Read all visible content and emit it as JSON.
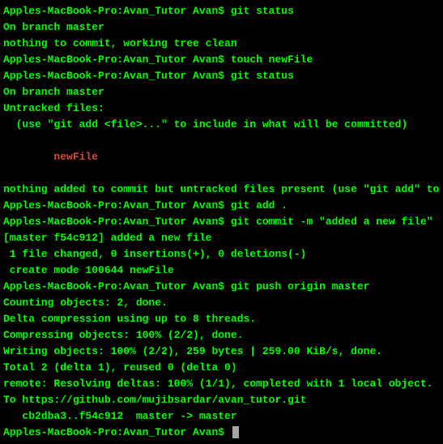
{
  "lines": [
    {
      "segments": [
        {
          "cls": "prompt",
          "key": "l0s0"
        },
        {
          "cls": "cmd",
          "key": "l0s1"
        }
      ],
      "l0s0": "Apples-MacBook-Pro:Avan_Tutor Avan$ ",
      "l0s1": "git status"
    },
    {
      "segments": [
        {
          "cls": "out",
          "key": "l1s0"
        }
      ],
      "l1s0": "On branch master"
    },
    {
      "segments": [
        {
          "cls": "out",
          "key": "l2s0"
        }
      ],
      "l2s0": "nothing to commit, working tree clean"
    },
    {
      "segments": [
        {
          "cls": "prompt",
          "key": "l3s0"
        },
        {
          "cls": "cmd",
          "key": "l3s1"
        }
      ],
      "l3s0": "Apples-MacBook-Pro:Avan_Tutor Avan$ ",
      "l3s1": "touch newFile"
    },
    {
      "segments": [
        {
          "cls": "prompt",
          "key": "l4s0"
        },
        {
          "cls": "cmd",
          "key": "l4s1"
        }
      ],
      "l4s0": "Apples-MacBook-Pro:Avan_Tutor Avan$ ",
      "l4s1": "git status"
    },
    {
      "segments": [
        {
          "cls": "out",
          "key": "l5s0"
        }
      ],
      "l5s0": "On branch master"
    },
    {
      "segments": [
        {
          "cls": "out",
          "key": "l6s0"
        }
      ],
      "l6s0": "Untracked files:"
    },
    {
      "segments": [
        {
          "cls": "out",
          "key": "l7s0"
        }
      ],
      "l7s0": "  (use \"git add <file>...\" to include in what will be committed)"
    },
    {
      "blank": true
    },
    {
      "segments": [
        {
          "cls": "untracked",
          "key": "l9s0"
        }
      ],
      "l9s0": "        newFile"
    },
    {
      "blank": true
    },
    {
      "segments": [
        {
          "cls": "out",
          "key": "l11s0"
        }
      ],
      "l11s0": "nothing added to commit but untracked files present (use \"git add\" to track)"
    },
    {
      "segments": [
        {
          "cls": "prompt",
          "key": "l12s0"
        },
        {
          "cls": "cmd",
          "key": "l12s1"
        }
      ],
      "l12s0": "Apples-MacBook-Pro:Avan_Tutor Avan$ ",
      "l12s1": "git add ."
    },
    {
      "segments": [
        {
          "cls": "prompt",
          "key": "l13s0"
        },
        {
          "cls": "cmd",
          "key": "l13s1"
        }
      ],
      "l13s0": "Apples-MacBook-Pro:Avan_Tutor Avan$ ",
      "l13s1": "git commit -m \"added a new file\""
    },
    {
      "segments": [
        {
          "cls": "out",
          "key": "l14s0"
        }
      ],
      "l14s0": "[master f54c912] added a new file"
    },
    {
      "segments": [
        {
          "cls": "out",
          "key": "l15s0"
        }
      ],
      "l15s0": " 1 file changed, 0 insertions(+), 0 deletions(-)"
    },
    {
      "segments": [
        {
          "cls": "out",
          "key": "l16s0"
        }
      ],
      "l16s0": " create mode 100644 newFile"
    },
    {
      "segments": [
        {
          "cls": "prompt",
          "key": "l17s0"
        },
        {
          "cls": "cmd",
          "key": "l17s1"
        }
      ],
      "l17s0": "Apples-MacBook-Pro:Avan_Tutor Avan$ ",
      "l17s1": "git push origin master"
    },
    {
      "segments": [
        {
          "cls": "out",
          "key": "l18s0"
        }
      ],
      "l18s0": "Counting objects: 2, done."
    },
    {
      "segments": [
        {
          "cls": "out",
          "key": "l19s0"
        }
      ],
      "l19s0": "Delta compression using up to 8 threads."
    },
    {
      "segments": [
        {
          "cls": "out",
          "key": "l20s0"
        }
      ],
      "l20s0": "Compressing objects: 100% (2/2), done."
    },
    {
      "segments": [
        {
          "cls": "out",
          "key": "l21s0"
        }
      ],
      "l21s0": "Writing objects: 100% (2/2), 259 bytes | 259.00 KiB/s, done."
    },
    {
      "segments": [
        {
          "cls": "out",
          "key": "l22s0"
        }
      ],
      "l22s0": "Total 2 (delta 1), reused 0 (delta 0)"
    },
    {
      "segments": [
        {
          "cls": "out",
          "key": "l23s0"
        }
      ],
      "l23s0": "remote: Resolving deltas: 100% (1/1), completed with 1 local object."
    },
    {
      "segments": [
        {
          "cls": "out",
          "key": "l24s0"
        }
      ],
      "l24s0": "To https://github.com/mujibsardar/avan_tutor.git"
    },
    {
      "segments": [
        {
          "cls": "out",
          "key": "l25s0"
        }
      ],
      "l25s0": "   cb2dba3..f54c912  master -> master"
    },
    {
      "segments": [
        {
          "cls": "prompt",
          "key": "l26s0"
        }
      ],
      "l26s0": "Apples-MacBook-Pro:Avan_Tutor Avan$ ",
      "cursor": true
    }
  ]
}
